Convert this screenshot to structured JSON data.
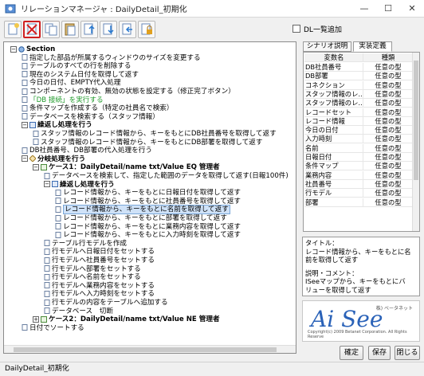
{
  "window": {
    "title": "リレーションマネージャ : DailyDetail_初期化",
    "minimize": "—",
    "maximize": "☐",
    "close": "✕"
  },
  "toolbar": {
    "buttons": [
      "new-icon",
      "delete-icon",
      "copy-icon",
      "paste-icon",
      "up-icon",
      "down-icon",
      "outdent-icon",
      "lock-icon"
    ],
    "selected_index": 1
  },
  "dl_add": {
    "label": "DL一覧追加",
    "checked": false
  },
  "tree": {
    "rows": [
      {
        "text": "Section",
        "style": "bold",
        "expander": "−"
      },
      {
        "text": "指定した部品が所属するウィンドウのサイズを変更する"
      },
      {
        "text": "テーブルのすべての行を削除する"
      },
      {
        "text": "現在のシステム日付を取得して返す"
      },
      {
        "text": "今日の日付、EMPTY代入処理"
      },
      {
        "text": "コンポーネントの有効、無効の状態を設定する（修正完了ボタン）"
      },
      {
        "text": "「DB 接続」を実行する",
        "style": "green"
      },
      {
        "text": "条件マップを作成する（特定の社員名で検索）"
      },
      {
        "text": "データベースを検索する（スタッフ情報）"
      },
      {
        "text": "繰返し処理を行う",
        "style": "bold",
        "expander": "−"
      },
      {
        "text": "スタッフ情報のレコード情報から、キーをもとにDB社員番号を取得して返す"
      },
      {
        "text": "スタッフ情報のレコード情報から、キーをもとにDB部署を取得して返す"
      },
      {
        "text": "DB社員番号、DB部署の代入処理を行う"
      },
      {
        "text": "分岐処理を行う",
        "style": "bold",
        "expander": "−"
      },
      {
        "text": "ケース1：DailyDetail/name txt/Value EQ 管理者",
        "style": "bold",
        "expander": "−"
      },
      {
        "text": "データベースを検索して、指定した範囲のデータを取得して返す(日報100件)"
      },
      {
        "text": "繰返し処理を行う",
        "style": "bold",
        "expander": "−"
      },
      {
        "text": "レコード情報から、キーをもとに日報日付を取得して返す"
      },
      {
        "text": "レコード情報から、キーをもとに社員番号を取得して返す"
      },
      {
        "text": "レコード情報から、キーをもとに名前を取得して返す",
        "style": "sel"
      },
      {
        "text": "レコード情報から、キーをもとに部署を取得して返す"
      },
      {
        "text": "レコード情報から、キーをもとに業務内容を取得して返す"
      },
      {
        "text": "レコード情報から、キーをもとに入力時刻を取得して返す"
      },
      {
        "text": "テーブル行モデルを作成"
      },
      {
        "text": "行モデルへ日報日付をセットする"
      },
      {
        "text": "行モデルへ社員番号をセットする"
      },
      {
        "text": "行モデルへ部署をセットする"
      },
      {
        "text": "行モデルへ名前をセットする"
      },
      {
        "text": "行モデルへ業務内容をセットする"
      },
      {
        "text": "行モデルへ入力時刻をセットする"
      },
      {
        "text": "行モデルの内容をテーブルへ追加する"
      },
      {
        "text": "データベース　切断"
      },
      {
        "text": "ケース2：DailyDetail/name txt/Value NE 管理者",
        "style": "bold",
        "expander": "+"
      },
      {
        "text": "日付でソートする"
      }
    ]
  },
  "tabs": {
    "scenario": "シナリオ説明",
    "implementation": "実装定義"
  },
  "grid": {
    "headers": [
      "変数名",
      "種類"
    ],
    "rows": [
      [
        "DB社員番号",
        "任意の型"
      ],
      [
        "DB部署",
        "任意の型"
      ],
      [
        "コネクション",
        "任意の型"
      ],
      [
        "スタッフ情報のレ…",
        "任意の型"
      ],
      [
        "スタッフ情報のレ…",
        "任意の型"
      ],
      [
        "レコードセット",
        "任意の型"
      ],
      [
        "レコード情報",
        "任意の型"
      ],
      [
        "今日の日付",
        "任意の型"
      ],
      [
        "入力時刻",
        "任意の型"
      ],
      [
        "名前",
        "任意の型"
      ],
      [
        "日報日付",
        "任意の型"
      ],
      [
        "条件マップ",
        "任意の型"
      ],
      [
        "業務内容",
        "任意の型"
      ],
      [
        "社員番号",
        "任意の型"
      ],
      [
        "行モデル",
        "任意の型"
      ],
      [
        "部署",
        "任意の型"
      ]
    ]
  },
  "description": {
    "title_line": "タイトル：",
    "title_text": "レコード情報から、キーをもとに名前を取得して返す",
    "comment_line": "説明・コメント：",
    "comment_text": "ISeeマップから、キーをもとにバリューを取得して返す"
  },
  "logo": {
    "maker": "株) ベータネット",
    "text": "Ai See",
    "copyright": "Copyright(c) 2009 Betanet Corporation. All Rights Reserve"
  },
  "buttons": {
    "confirm": "確定",
    "save": "保存",
    "close": "閉じる"
  },
  "status": "DailyDetail_初期化",
  "colors": {
    "accent_selected": "#cfe2f8",
    "green_item": "#1f9a2a",
    "logo_blue": "#2a62b8"
  }
}
